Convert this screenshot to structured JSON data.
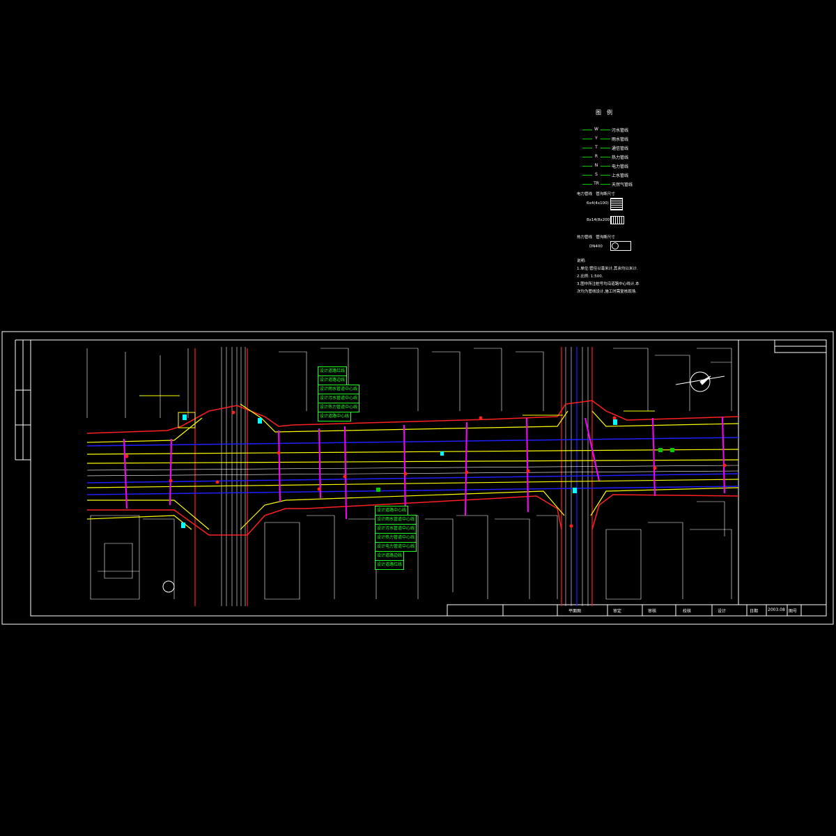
{
  "legend": {
    "title": "图例",
    "items": [
      {
        "code": "W",
        "name": "污水管线",
        "color": "#00cc00"
      },
      {
        "code": "Y",
        "name": "雨水管线",
        "color": "#00cc00"
      },
      {
        "code": "T",
        "name": "通信管线",
        "color": "#00cc00"
      },
      {
        "code": "R",
        "name": "热力管线",
        "color": "#00cc00"
      },
      {
        "code": "N",
        "name": "电力管线",
        "color": "#00cc00"
      },
      {
        "code": "S",
        "name": "上水管线",
        "color": "#00cc00"
      },
      {
        "code": "TR",
        "name": "天然气管线",
        "color": "#00cc00"
      }
    ],
    "power_header": [
      "电力管线",
      "管沟断尺寸"
    ],
    "power_rows": [
      "6x4(4x100)",
      "8x14(8x200)"
    ],
    "heat_header": [
      "热力管线",
      "管沟断尺寸"
    ],
    "heat_row": "DN400"
  },
  "notes": {
    "title": "说明:",
    "lines": [
      "1.单位:管径以毫米计,其余均以米计.",
      "2.比例: 1:500.",
      "3.图中所注桩号均沿道路中心线计,本",
      "  次均为管线设计,施工时需复核现场."
    ]
  },
  "green_labels_top": [
    "设计道路红线",
    "设计道路边线",
    "设计雨水管道中心线",
    "设计污水管道中心线",
    "设计热力管道中心线",
    "设计道路中心线"
  ],
  "green_labels_bottom": [
    "设计道路中心线",
    "设计雨水管道中心线",
    "设计污水管道中心线",
    "设计热力管道中心线",
    "设计电力管道中心线",
    "设计道路边线",
    "设计道路红线"
  ],
  "title_block": {
    "drawing_name": "平面图",
    "approve": "审定",
    "review": "审核",
    "check": "校核",
    "design": "设计",
    "date_label": "日期",
    "date_value": "2003.08",
    "drawing_no_label": "图号"
  },
  "colors": {
    "red_line": "#ff2020",
    "yellow_line": "#ffff00",
    "blue_line": "#2020ff",
    "magenta": "#ff00ff",
    "green": "#00cc00",
    "white": "#ffffff",
    "cyan": "#00ffff"
  }
}
